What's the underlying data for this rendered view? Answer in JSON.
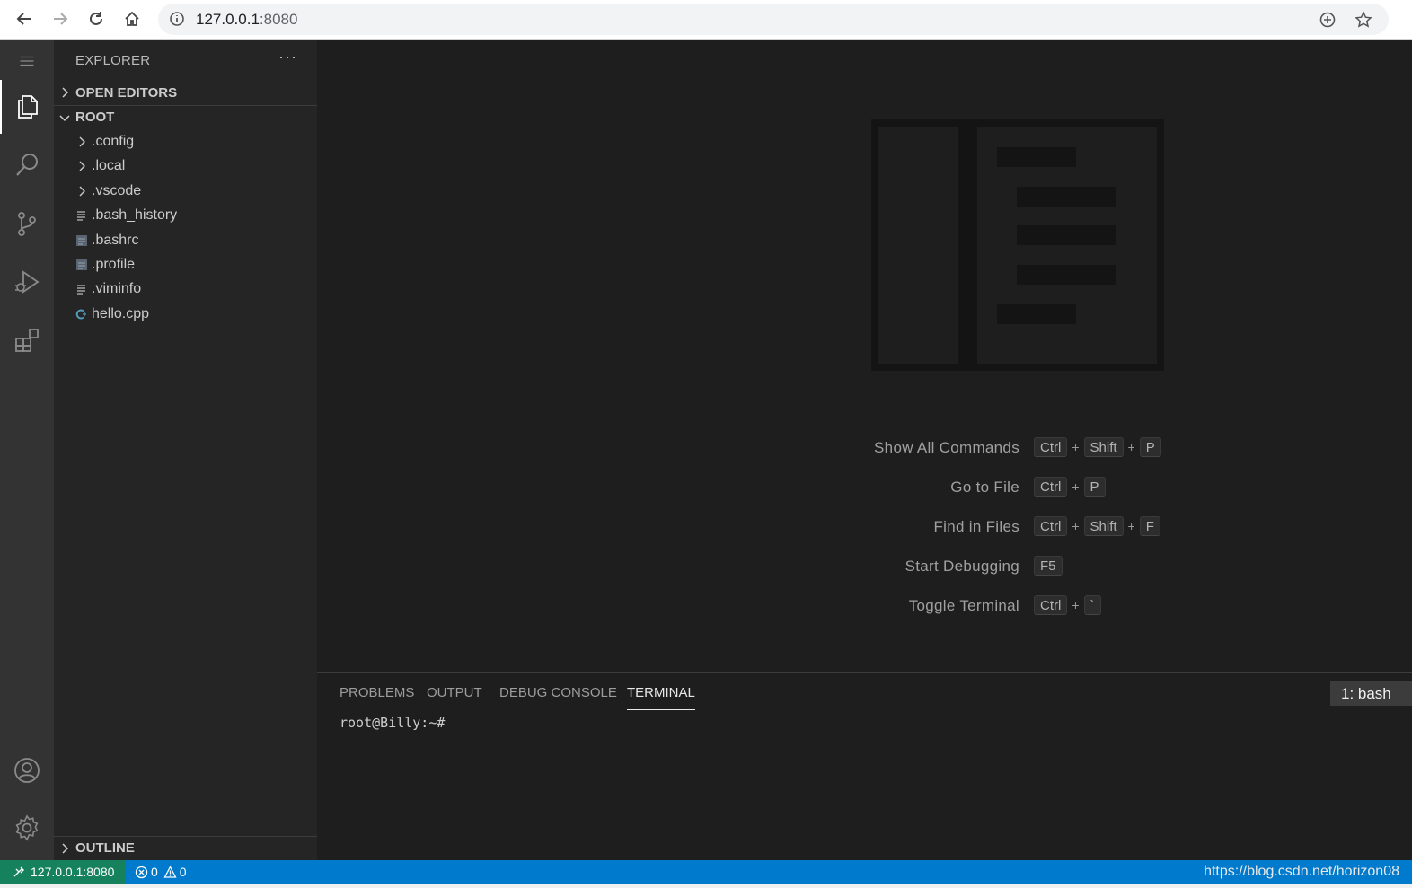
{
  "browser": {
    "url_host": "127.0.0.1",
    "url_port": ":8080",
    "icons": [
      "back-arrow-icon",
      "forward-arrow-icon",
      "reload-icon",
      "home-icon",
      "info-icon",
      "zoom-icon",
      "star-icon"
    ]
  },
  "activity_bar": {
    "items": [
      "explorer",
      "search",
      "source-control",
      "run-debug",
      "extensions",
      "accounts",
      "manage"
    ]
  },
  "sidebar": {
    "title": "EXPLORER",
    "more": "···",
    "sections": {
      "open_editors": "OPEN EDITORS",
      "root": "ROOT",
      "outline": "OUTLINE"
    },
    "tree": [
      {
        "label": ".config",
        "type": "folder"
      },
      {
        "label": ".local",
        "type": "folder"
      },
      {
        "label": ".vscode",
        "type": "folder"
      },
      {
        "label": ".bash_history",
        "type": "text-file"
      },
      {
        "label": ".bashrc",
        "type": "shell-file"
      },
      {
        "label": ".profile",
        "type": "shell-file"
      },
      {
        "label": ".viminfo",
        "type": "text-file"
      },
      {
        "label": "hello.cpp",
        "type": "cpp-file"
      }
    ]
  },
  "editor": {
    "shortcuts": [
      {
        "label": "Show All Commands",
        "keys": [
          "Ctrl",
          "Shift",
          "P"
        ]
      },
      {
        "label": "Go to File",
        "keys": [
          "Ctrl",
          "P"
        ]
      },
      {
        "label": "Find in Files",
        "keys": [
          "Ctrl",
          "Shift",
          "F"
        ]
      },
      {
        "label": "Start Debugging",
        "keys": [
          "F5"
        ]
      },
      {
        "label": "Toggle Terminal",
        "keys": [
          "Ctrl",
          "`"
        ]
      }
    ],
    "plus": "+"
  },
  "panel": {
    "tabs": [
      "PROBLEMS",
      "OUTPUT",
      "DEBUG CONSOLE",
      "TERMINAL"
    ],
    "active_tab": "TERMINAL",
    "terminal_select": "1: bash",
    "terminal_prompt": "root@Billy:~#"
  },
  "status_bar": {
    "remote": "127.0.0.1:8080",
    "errors": "0",
    "warnings": "0",
    "watermark": "https://blog.csdn.net/horizon08"
  },
  "colors": {
    "status_bar": "#007acc",
    "remote_indicator": "#16825d",
    "activity_bar": "#333333",
    "sidebar": "#252526",
    "editor": "#1e1e1e"
  }
}
